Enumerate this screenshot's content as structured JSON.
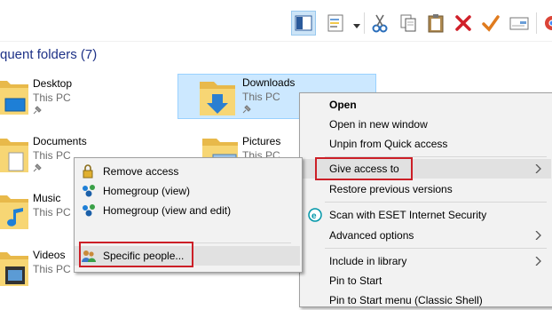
{
  "section": {
    "title": "quent folders (7)"
  },
  "folders": [
    {
      "name": "Desktop",
      "location": "This PC"
    },
    {
      "name": "Downloads",
      "location": "This PC"
    },
    {
      "name": "Documents",
      "location": "This PC"
    },
    {
      "name": "Pictures",
      "location": "This PC"
    },
    {
      "name": "Music",
      "location": "This PC"
    },
    {
      "name": "Videos",
      "location": "This PC"
    }
  ],
  "context_menu": {
    "items": [
      {
        "label": "Open"
      },
      {
        "label": "Open in new window"
      },
      {
        "label": "Unpin from Quick access"
      },
      {
        "label": "Give access to"
      },
      {
        "label": "Restore previous versions"
      },
      {
        "label": "Scan with ESET Internet Security"
      },
      {
        "label": "Advanced options"
      },
      {
        "label": "Include in library"
      },
      {
        "label": "Pin to Start"
      },
      {
        "label": "Pin to Start menu (Classic Shell)"
      }
    ]
  },
  "submenu": {
    "items": [
      {
        "label": "Remove access"
      },
      {
        "label": "Homegroup (view)"
      },
      {
        "label": "Homegroup (view and edit)"
      },
      {
        "label": "Specific people..."
      }
    ]
  },
  "colors": {
    "highlight_box": "#cc1f27",
    "selection": "#cce8ff",
    "menu_background": "#f2f2f2",
    "section_title": "#1e3287"
  }
}
